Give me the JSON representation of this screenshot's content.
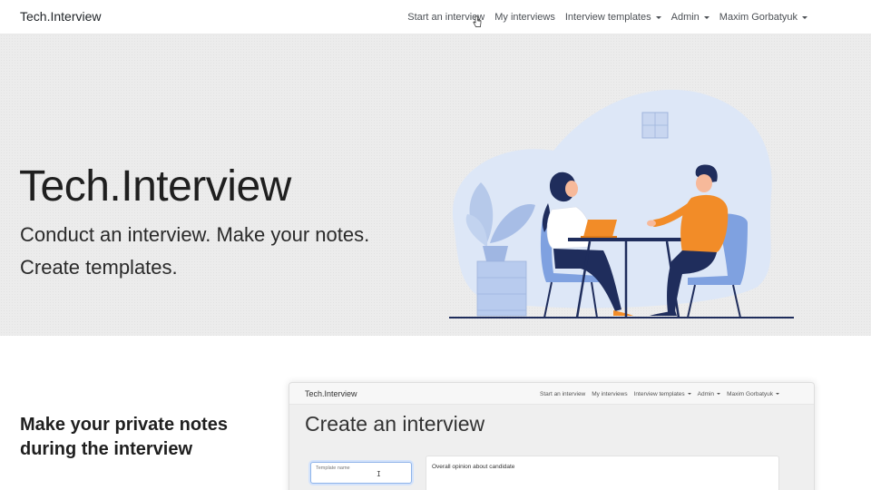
{
  "navbar": {
    "brand": "Tech.Interview",
    "links": [
      {
        "label": "Start an interview",
        "dropdown": false
      },
      {
        "label": "My interviews",
        "dropdown": false
      },
      {
        "label": "Interview templates",
        "dropdown": true
      },
      {
        "label": "Admin",
        "dropdown": true
      },
      {
        "label": "Maxim Gorbatyuk",
        "dropdown": true
      }
    ]
  },
  "hero": {
    "title": "Tech.Interview",
    "subtitle": "Conduct an interview. Make your notes. Create templates.",
    "illustration": "interview-illustration"
  },
  "feature": {
    "title": "Make your private notes during the interview"
  },
  "preview": {
    "brand": "Tech.Interview",
    "links": [
      {
        "label": "Start an interview",
        "dropdown": false
      },
      {
        "label": "My interviews",
        "dropdown": false
      },
      {
        "label": "Interview templates",
        "dropdown": true
      },
      {
        "label": "Admin",
        "dropdown": true
      },
      {
        "label": "Maxim Gorbatyuk",
        "dropdown": true
      }
    ],
    "page_title": "Create an interview",
    "template_input_label": "Template name",
    "opinion_label": "Overall opinion about candidate"
  },
  "colors": {
    "hero_bg": "#ececec",
    "accent_orange": "#f28c28",
    "navy": "#1f2d5c",
    "chair_blue": "#7fa1e0",
    "blob_blue": "#dde7f7"
  }
}
